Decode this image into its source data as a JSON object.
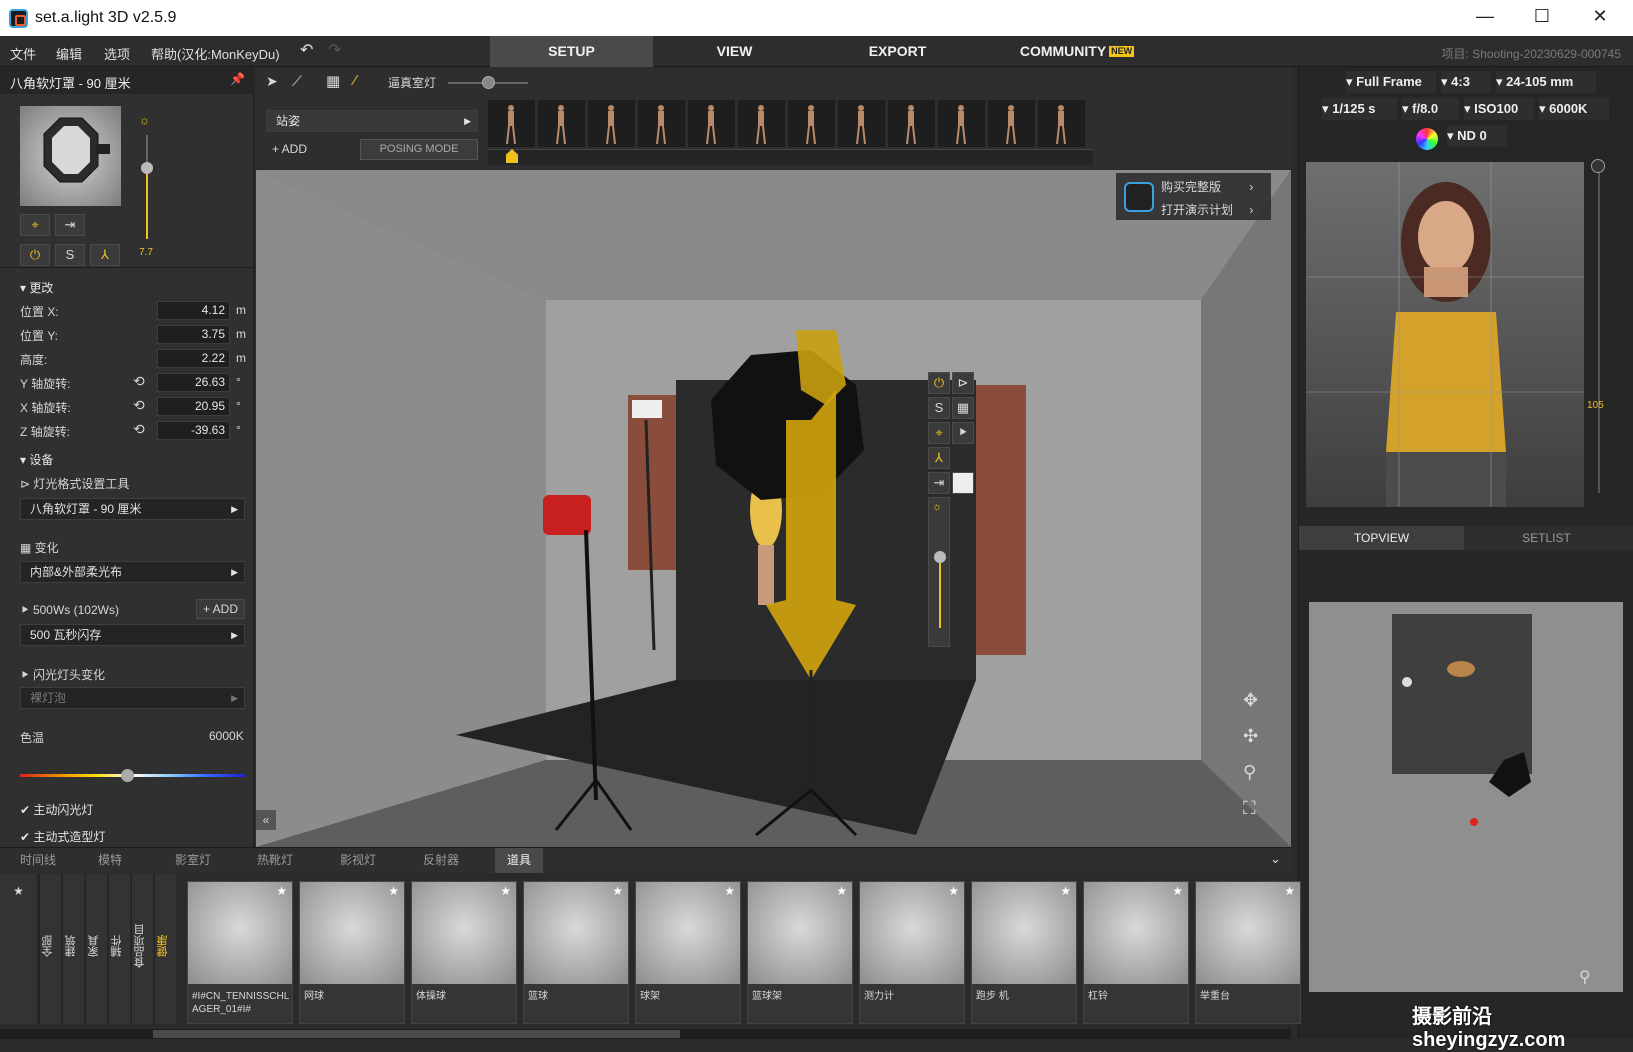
{
  "app": {
    "title": "set.a.light 3D v2.5.9"
  },
  "menu": [
    "文件",
    "编辑",
    "选项",
    "帮助(汉化:MonKeyDu)"
  ],
  "modes": {
    "setup": "SETUP",
    "view": "VIEW",
    "export": "EXPORT",
    "community": "COMMUNITY",
    "new_badge": "NEW"
  },
  "project": "项目: Shooting-20230629-000745",
  "left": {
    "header": "八角软灯罩 - 90 厘米",
    "section_modify": "更改",
    "fields": [
      {
        "label": "位置 X:",
        "value": "4.12",
        "unit": "m"
      },
      {
        "label": "位置 Y:",
        "value": "3.75",
        "unit": "m"
      },
      {
        "label": "高度:",
        "value": "2.22",
        "unit": "m"
      },
      {
        "label": "Y 轴旋转:",
        "value": "26.63",
        "unit": "°"
      },
      {
        "label": "X 轴旋转:",
        "value": "20.95",
        "unit": "°"
      },
      {
        "label": "Z 轴旋转:",
        "value": "-39.63",
        "unit": "°"
      }
    ],
    "section_device": "设备",
    "light_tool": "灯光格式设置工具",
    "modifier": "八角软灯罩 - 90 厘米",
    "variation_label": "变化",
    "variation": "内部&外部柔光布",
    "power_label": "500Ws (102Ws)",
    "add": "ADD",
    "flash": "500 瓦秒闪存",
    "head_label": "闪光灯头变化",
    "head": "裸灯泡",
    "temp_label": "色温",
    "temp_value": "6000K",
    "chk1": "主动闪光灯",
    "chk2": "主动式造型灯",
    "s_label": "S",
    "brightness_mark": "7.7"
  },
  "toolbar": {
    "ambient": "逼真室灯",
    "pose": "站姿",
    "add": "ADD",
    "posing_mode": "POSING MODE"
  },
  "promo": {
    "buy": "购买完整版",
    "demo": "打开演示计划"
  },
  "camera": {
    "frame": "Full Frame",
    "ratio": "4:3",
    "lens": "24-105 mm",
    "shutter": "1/125 s",
    "aperture": "f/8.0",
    "iso": "ISO100",
    "wb": "6000K",
    "nd": "ND 0",
    "zoom": "105"
  },
  "views": {
    "topview": "TOPVIEW",
    "setlist": "SETLIST"
  },
  "bottom": {
    "tabs": [
      "时间线",
      "模特",
      "影室灯",
      "热靴灯",
      "影视灯",
      "反射器",
      "道具"
    ],
    "categories": [
      "全部",
      "建筑",
      "家具",
      "辅件",
      "食品项目",
      "健康"
    ],
    "props": [
      "#I#CN_TENNISSCHLAGER_01#I#",
      "网球",
      "体操球",
      "篮球",
      "球架",
      "篮球架",
      "测力计",
      "跑步 机",
      "杠铃",
      "举重台"
    ]
  },
  "watermark": "摄影前沿 sheyingzyz.com",
  "colors": {
    "accent": "#f0c020",
    "active_tab": "#4a4a4a"
  }
}
